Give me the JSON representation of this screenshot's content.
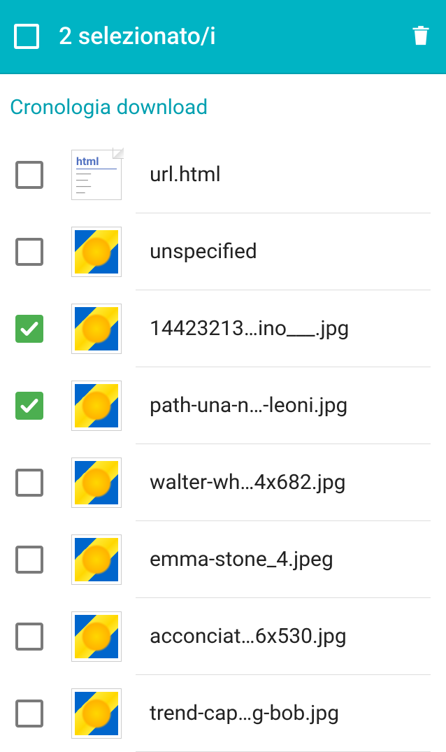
{
  "header": {
    "title": "2 selezionato/i",
    "select_all_checked": false
  },
  "section_title": "Cronologia download",
  "items": [
    {
      "filename": "url.html",
      "checked": false,
      "type": "html"
    },
    {
      "filename": "unspecified",
      "checked": false,
      "type": "image"
    },
    {
      "filename": "14423213…ino___.jpg",
      "checked": true,
      "type": "image"
    },
    {
      "filename": "path-una-n…-leoni.jpg",
      "checked": true,
      "type": "image"
    },
    {
      "filename": "walter-wh…4x682.jpg",
      "checked": false,
      "type": "image"
    },
    {
      "filename": "emma-stone_4.jpeg",
      "checked": false,
      "type": "image"
    },
    {
      "filename": "acconciat…6x530.jpg",
      "checked": false,
      "type": "image"
    },
    {
      "filename": "trend-cap…g-bob.jpg",
      "checked": false,
      "type": "image"
    }
  ]
}
